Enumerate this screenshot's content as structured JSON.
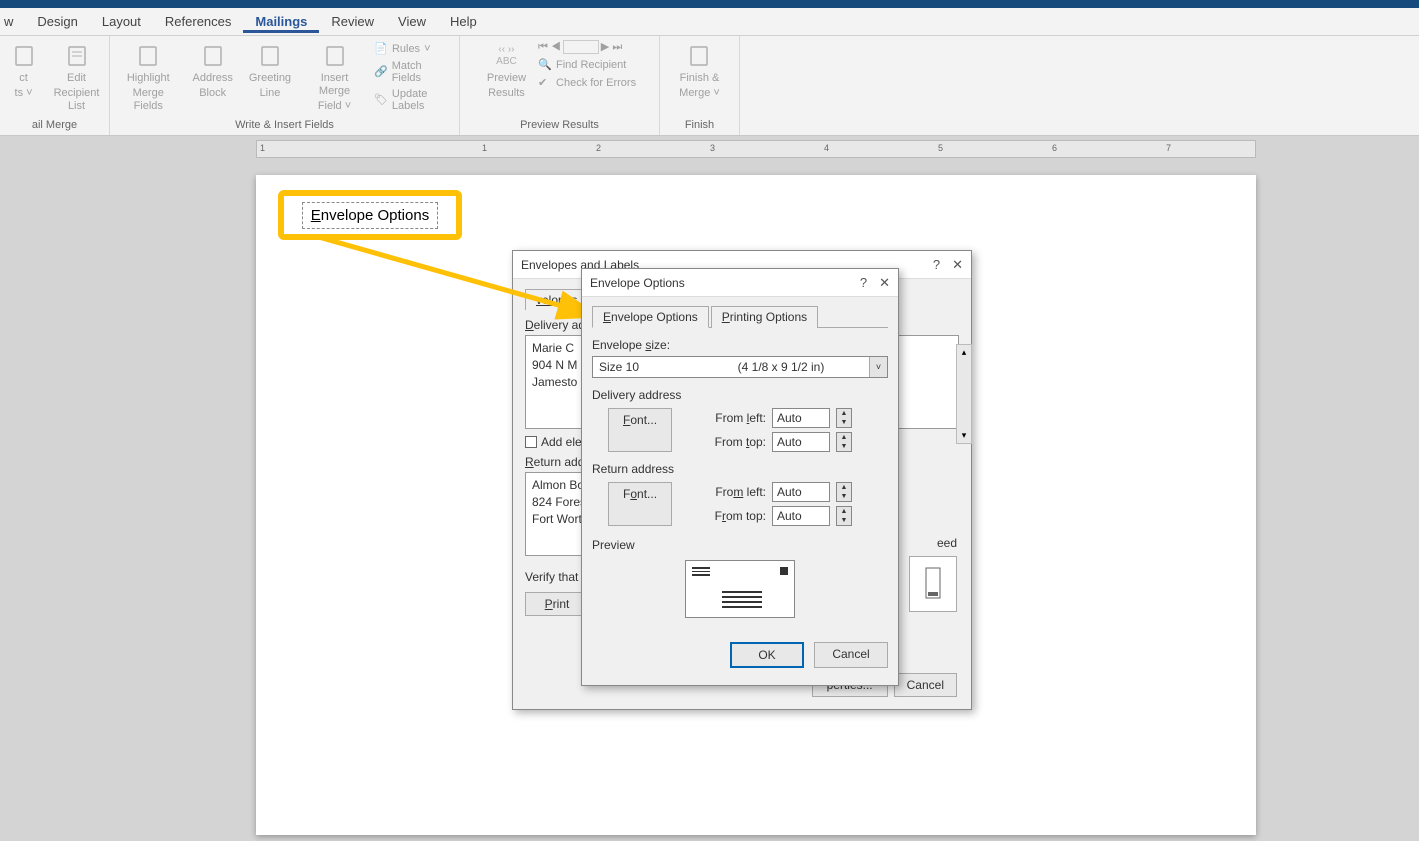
{
  "tabs": {
    "partial": "w",
    "design": "Design",
    "layout": "Layout",
    "references": "References",
    "mailings": "Mailings",
    "review": "Review",
    "view": "View",
    "help": "Help"
  },
  "ribbon": {
    "group1": {
      "partial_btn1": "ct",
      "partial_btn1_line2": "ts",
      "edit_btn": "Edit",
      "edit_btn_line2": "Recipient List",
      "label": "ail Merge"
    },
    "group2": {
      "highlight": "Highlight",
      "highlight_line2": "Merge Fields",
      "address": "Address",
      "address_line2": "Block",
      "greeting": "Greeting",
      "greeting_line2": "Line",
      "insert_merge": "Insert Merge",
      "insert_merge_line2": "Field",
      "rules": "Rules",
      "match": "Match Fields",
      "update": "Update Labels",
      "label": "Write & Insert Fields"
    },
    "group3": {
      "preview": "Preview",
      "preview_line2": "Results",
      "find": "Find Recipient",
      "check": "Check for Errors",
      "label": "Preview Results"
    },
    "group4": {
      "finish": "Finish &",
      "finish_line2": "Merge",
      "label": "Finish"
    }
  },
  "ruler": {
    "marks": [
      1,
      2,
      3,
      4,
      5,
      6,
      7
    ]
  },
  "callout": {
    "text": "Envelope Options"
  },
  "dialog_back": {
    "title": "Envelopes and Labels",
    "tab_envelopes": "velopes",
    "delivery_lbl": "Delivery ad",
    "delivery_text": "Marie C\n904 N M\nJamesto",
    "add_ele": "Add ele",
    "return_lbl": "Return add",
    "return_text": "Almon Bo\n824 Fores\nFort Wort",
    "feed": "eed",
    "verify": "Verify that",
    "print_btn": "Print",
    "perties_btn": "perties...",
    "cancel_btn": "Cancel"
  },
  "dialog_front": {
    "title": "Envelope Options",
    "help": "?",
    "close": "✕",
    "tab_env": "Envelope Options",
    "tab_print": "Printing Options",
    "size_lbl": "Envelope size:",
    "size_sel": "Size 10",
    "size_desc": "(4 1/8 x 9 1/2 in)",
    "dropdown_arrow": "˅",
    "delivery": {
      "title": "Delivery address",
      "font": "Font...",
      "from_left": "From left:",
      "from_top": "From top:",
      "left_val": "Auto",
      "top_val": "Auto"
    },
    "return": {
      "title": "Return address",
      "font": "Font...",
      "from_left": "From left:",
      "from_top": "From top:",
      "left_val": "Auto",
      "top_val": "Auto"
    },
    "preview_lbl": "Preview",
    "ok": "OK",
    "cancel": "Cancel",
    "spin_up": "▲",
    "spin_down": "▼"
  }
}
